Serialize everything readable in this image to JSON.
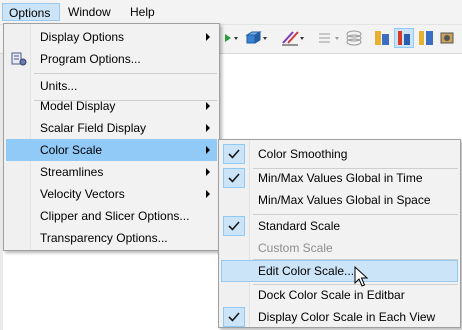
{
  "menubar": {
    "items": [
      {
        "label": "Options"
      },
      {
        "label": "Window"
      },
      {
        "label": "Help"
      }
    ]
  },
  "options_menu": {
    "items": [
      {
        "label": "Display Options",
        "has_submenu": true
      },
      {
        "label": "Program Options...",
        "has_submenu": false
      },
      {
        "label": "Units...",
        "has_submenu": false
      },
      {
        "label": "Model Display",
        "has_submenu": true
      },
      {
        "label": "Scalar Field Display",
        "has_submenu": true
      },
      {
        "label": "Color Scale",
        "has_submenu": true,
        "highlighted": true
      },
      {
        "label": "Streamlines",
        "has_submenu": true
      },
      {
        "label": "Velocity Vectors",
        "has_submenu": true
      },
      {
        "label": "Clipper and Slicer Options...",
        "has_submenu": false
      },
      {
        "label": "Transparency Options...",
        "has_submenu": false
      }
    ]
  },
  "color_scale_submenu": {
    "items": [
      {
        "label": "Color Smoothing",
        "checked": true,
        "enabled": true
      },
      {
        "label": "Min/Max Values Global in Time",
        "checked": true,
        "enabled": true
      },
      {
        "label": "Min/Max Values Global in Space",
        "checked": false,
        "enabled": true
      },
      {
        "label": "Standard Scale",
        "checked": true,
        "enabled": true
      },
      {
        "label": "Custom Scale",
        "checked": false,
        "enabled": false
      },
      {
        "label": "Edit Color Scale...",
        "checked": false,
        "enabled": true,
        "hovered": true
      },
      {
        "label": "Dock Color Scale in Editbar",
        "checked": false,
        "enabled": true
      },
      {
        "label": "Display Color Scale in Each View",
        "checked": true,
        "enabled": true
      }
    ]
  },
  "colors": {
    "menu_highlight": "#91c9f7",
    "hover": "#cce4f7",
    "menubar_open": "#cce4f7",
    "disabled_text": "#8d8d8d"
  }
}
